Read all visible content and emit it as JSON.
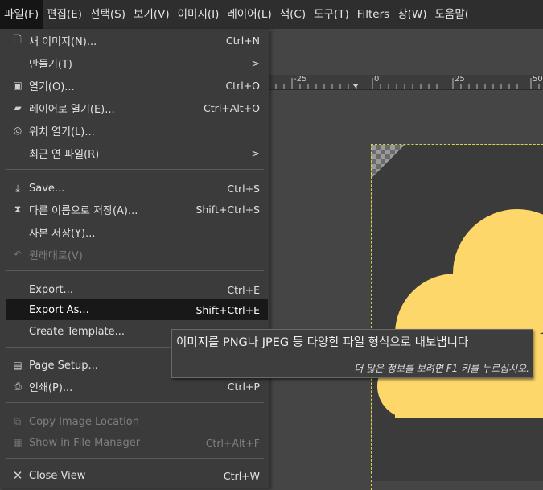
{
  "menubar": {
    "items": [
      "파일(F)",
      "편집(E)",
      "선택(S)",
      "보기(V)",
      "이미지(I)",
      "레이어(L)",
      "색(C)",
      "도구(T)",
      "Filters",
      "창(W)",
      "도움말("
    ]
  },
  "ruler": {
    "labels": [
      "-25",
      "0",
      "25",
      "50"
    ]
  },
  "file_menu": {
    "items": [
      {
        "label": "새 이미지(N)...",
        "accel": "Ctrl+N",
        "icon": "new-image-icon"
      },
      {
        "label": "만들기(T)",
        "accel": ">",
        "icon": ""
      },
      {
        "label": "열기(O)...",
        "accel": "Ctrl+O",
        "icon": "open-icon"
      },
      {
        "label": "레이어로 열기(E)...",
        "accel": "Ctrl+Alt+O",
        "icon": "open-as-layers-icon"
      },
      {
        "label": "위치 열기(L)...",
        "accel": "",
        "icon": "open-location-icon"
      },
      {
        "label": "최근 연 파일(R)",
        "accel": ">",
        "icon": ""
      },
      {
        "label": "Save...",
        "accel": "Ctrl+S",
        "icon": "save-icon"
      },
      {
        "label": "다른 이름으로 저장(A)...",
        "accel": "Shift+Ctrl+S",
        "icon": "save-as-icon"
      },
      {
        "label": "사본 저장(Y)...",
        "accel": "",
        "icon": ""
      },
      {
        "label": "원래대로(V)",
        "accel": "",
        "icon": "revert-icon"
      },
      {
        "label": "Export...",
        "accel": "Ctrl+E",
        "icon": ""
      },
      {
        "label": "Export As...",
        "accel": "Shift+Ctrl+E",
        "icon": ""
      },
      {
        "label": "Create Template...",
        "accel": "",
        "icon": ""
      },
      {
        "label": "Page Setup...",
        "accel": "",
        "icon": "page-setup-icon"
      },
      {
        "label": "인쇄(P)...",
        "accel": "Ctrl+P",
        "icon": "print-icon"
      },
      {
        "label": "Copy Image Location",
        "accel": "",
        "icon": "copy-location-icon"
      },
      {
        "label": "Show in File Manager",
        "accel": "Ctrl+Alt+F",
        "icon": "file-manager-icon"
      },
      {
        "label": "Close View",
        "accel": "Ctrl+W",
        "icon": "close-icon"
      }
    ]
  },
  "tooltip": {
    "text": "이미지를 PNG나 JPEG 등 다양한 파일 형식으로 내보냅니다",
    "hint": "더 많은 정보를 보려면 F1 키를 누르십시오."
  },
  "colors": {
    "cloud": "#fdd76a",
    "selection_border": "#d6d64a",
    "menu_bg": "#3b3b3b",
    "highlight_bg": "#181818"
  }
}
